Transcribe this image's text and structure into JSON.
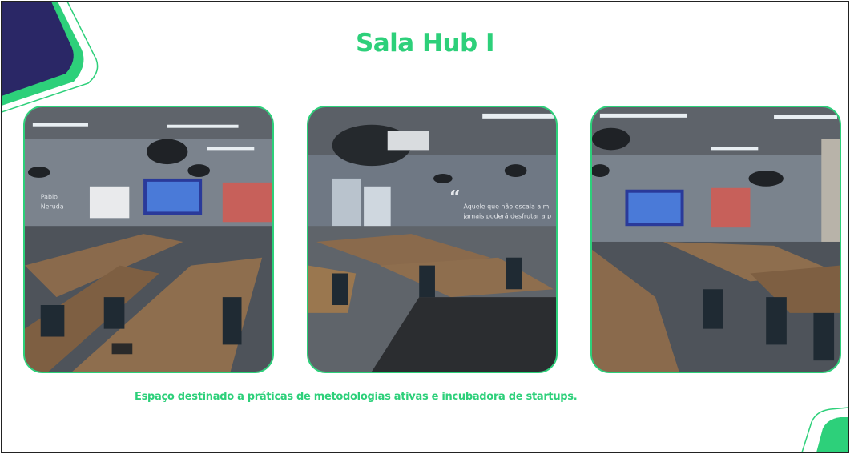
{
  "slide": {
    "title": "Sala Hub I",
    "caption": "Espaço destinado a práticas de metodologias ativas e incubadora de startups."
  },
  "photos": [
    {
      "alt": "Sala Hub I - vista 1",
      "wall_text": [
        "Pablo",
        "Neruda"
      ]
    },
    {
      "alt": "Sala Hub I - vista 2",
      "wall_text": [
        "Aquele que não escala a m",
        "jamais poderá desfrutar a p"
      ]
    },
    {
      "alt": "Sala Hub I - vista 3"
    }
  ],
  "colors": {
    "accent": "#2dd07a",
    "navy": "#2a2766",
    "frame": "#222222"
  }
}
